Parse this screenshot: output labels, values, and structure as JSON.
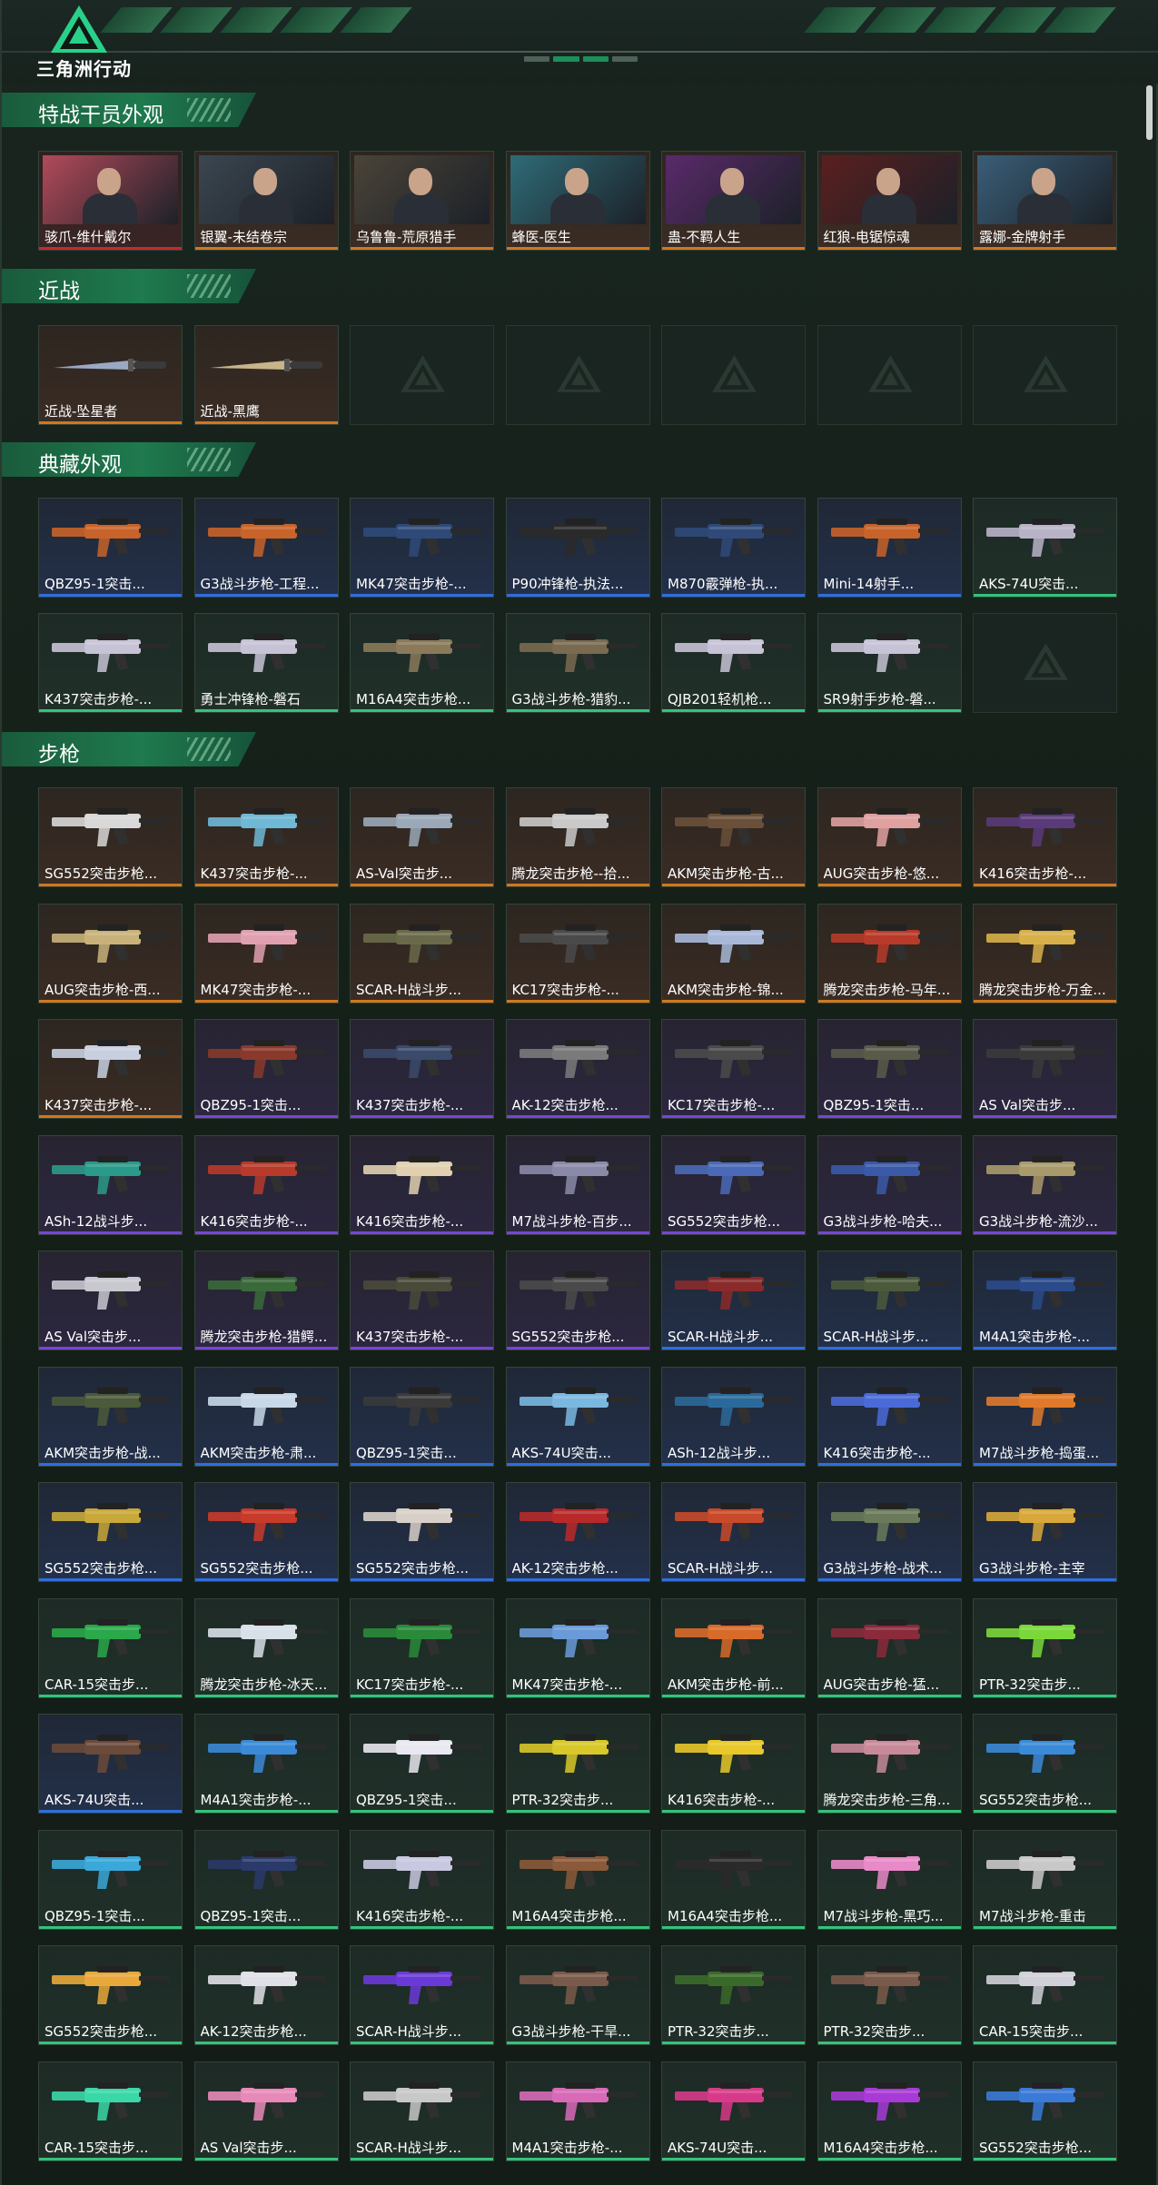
{
  "header": {
    "logo_text": "三角洲行动"
  },
  "sections": [
    {
      "key": "operators",
      "title": "特战干员外观",
      "rows": [
        [
          {
            "title": "骇爪-维什戴尔",
            "rarity": "red",
            "kind": "portrait",
            "tint": "#b24a5a"
          },
          {
            "title": "银翼-未结卷宗",
            "rarity": "orange",
            "kind": "portrait",
            "tint": "#3b4650"
          },
          {
            "title": "乌鲁鲁-荒原猎手",
            "rarity": "orange",
            "kind": "portrait",
            "tint": "#4a4338"
          },
          {
            "title": "蜂医-医生",
            "rarity": "orange",
            "kind": "portrait",
            "tint": "#2f6b77"
          },
          {
            "title": "蛊-不羁人生",
            "rarity": "orange",
            "kind": "portrait",
            "tint": "#5a2a6a"
          },
          {
            "title": "红狼-电锯惊魂",
            "rarity": "orange",
            "kind": "portrait",
            "tint": "#5a1f1f"
          },
          {
            "title": "露娜-金牌射手",
            "rarity": "orange",
            "kind": "portrait",
            "tint": "#3a5e78"
          }
        ]
      ]
    },
    {
      "key": "melee",
      "title": "近战",
      "rows": [
        [
          {
            "title": "近战-坠星者",
            "rarity": "orange",
            "kind": "knife",
            "tint": "#9aa8c4"
          },
          {
            "title": "近战-黑鹰",
            "rarity": "orange",
            "kind": "knife",
            "tint": "#c8b48a"
          },
          {
            "title": "",
            "rarity": "gray",
            "kind": "empty"
          },
          {
            "title": "",
            "rarity": "gray",
            "kind": "empty"
          },
          {
            "title": "",
            "rarity": "gray",
            "kind": "empty"
          },
          {
            "title": "",
            "rarity": "gray",
            "kind": "empty"
          },
          {
            "title": "",
            "rarity": "gray",
            "kind": "empty"
          }
        ]
      ]
    },
    {
      "key": "collection",
      "title": "典藏外观",
      "rows": [
        [
          {
            "title": "QBZ95-1突击...",
            "rarity": "blue",
            "kind": "gun",
            "tint": "#c8632a"
          },
          {
            "title": "G3战斗步枪-工程...",
            "rarity": "blue",
            "kind": "gun",
            "tint": "#c8632a"
          },
          {
            "title": "MK47突击步枪-...",
            "rarity": "blue",
            "kind": "gun",
            "tint": "#2f4a78"
          },
          {
            "title": "P90冲锋枪-执法...",
            "rarity": "blue",
            "kind": "gun",
            "tint": "#2a2a2a"
          },
          {
            "title": "M870霰弹枪-执...",
            "rarity": "blue",
            "kind": "gun",
            "tint": "#2f4a78"
          },
          {
            "title": "Mini-14射手...",
            "rarity": "blue",
            "kind": "gun",
            "tint": "#c8632a"
          },
          {
            "title": "AKS-74U突击...",
            "rarity": "green",
            "kind": "gun",
            "tint": "#b9b3c8"
          }
        ],
        [
          {
            "title": "K437突击步枪-...",
            "rarity": "green",
            "kind": "gun",
            "tint": "#c7c3d6"
          },
          {
            "title": "勇士冲锋枪-磐石",
            "rarity": "green",
            "kind": "gun",
            "tint": "#c7c3d6"
          },
          {
            "title": "M16A4突击步枪...",
            "rarity": "green",
            "kind": "gun",
            "tint": "#8a7a5a"
          },
          {
            "title": "G3战斗步枪-猎豹...",
            "rarity": "green",
            "kind": "gun",
            "tint": "#7a6a50"
          },
          {
            "title": "QJB201轻机枪...",
            "rarity": "green",
            "kind": "gun",
            "tint": "#c7c3d6"
          },
          {
            "title": "SR9射手步枪-磐...",
            "rarity": "green",
            "kind": "gun",
            "tint": "#c7c3d6"
          },
          {
            "title": "",
            "rarity": "gray",
            "kind": "empty"
          }
        ]
      ]
    },
    {
      "key": "rifles",
      "title": "步枪",
      "rows": [
        [
          {
            "title": "SG552突击步枪...",
            "rarity": "orange",
            "kind": "gun",
            "tint": "#d8d8d8"
          },
          {
            "title": "K437突击步枪-...",
            "rarity": "orange",
            "kind": "gun",
            "tint": "#6fb8d6"
          },
          {
            "title": "AS-Val突击步...",
            "rarity": "orange",
            "kind": "gun",
            "tint": "#9aa8b8"
          },
          {
            "title": "腾龙突击步枪--拾...",
            "rarity": "orange",
            "kind": "gun",
            "tint": "#c9c9c9"
          },
          {
            "title": "AKM突击步枪-古...",
            "rarity": "orange",
            "kind": "gun",
            "tint": "#6a5038"
          },
          {
            "title": "AUG突击步枪-悠...",
            "rarity": "orange",
            "kind": "gun",
            "tint": "#e0a0a0"
          },
          {
            "title": "K416突击步枪-...",
            "rarity": "orange",
            "kind": "gun",
            "tint": "#5a3a7a"
          }
        ],
        [
          {
            "title": "AUG突击步枪-西...",
            "rarity": "orange",
            "kind": "gun",
            "tint": "#c8b27a"
          },
          {
            "title": "MK47突击步枪-...",
            "rarity": "orange",
            "kind": "gun",
            "tint": "#e0a0b0"
          },
          {
            "title": "SCAR-H战斗步...",
            "rarity": "orange",
            "kind": "gun",
            "tint": "#6a6a4a"
          },
          {
            "title": "KC17突击步枪-...",
            "rarity": "orange",
            "kind": "gun",
            "tint": "#4a4a4a"
          },
          {
            "title": "AKM突击步枪-锦...",
            "rarity": "orange",
            "kind": "gun",
            "tint": "#a8b8d8"
          },
          {
            "title": "腾龙突击步枪-马年...",
            "rarity": "orange",
            "kind": "gun",
            "tint": "#b83a2a"
          },
          {
            "title": "腾龙突击步枪-万金...",
            "rarity": "orange",
            "kind": "gun",
            "tint": "#d8b04a"
          }
        ],
        [
          {
            "title": "K437突击步枪-...",
            "rarity": "orange",
            "kind": "gun",
            "tint": "#c8d0e0"
          },
          {
            "title": "QBZ95-1突击...",
            "rarity": "purple",
            "kind": "gun",
            "tint": "#8a3a2a"
          },
          {
            "title": "K437突击步枪-...",
            "rarity": "purple",
            "kind": "gun",
            "tint": "#3a4a6a"
          },
          {
            "title": "AK-12突击步枪...",
            "rarity": "purple",
            "kind": "gun",
            "tint": "#7a7a7a"
          },
          {
            "title": "KC17突击步枪-...",
            "rarity": "purple",
            "kind": "gun",
            "tint": "#4a4a4a"
          },
          {
            "title": "QBZ95-1突击...",
            "rarity": "purple",
            "kind": "gun",
            "tint": "#5a5a4a"
          },
          {
            "title": "AS Val突击步...",
            "rarity": "purple",
            "kind": "gun",
            "tint": "#3a3a3a"
          }
        ],
        [
          {
            "title": "ASh-12战斗步...",
            "rarity": "purple",
            "kind": "gun",
            "tint": "#2a9a8a"
          },
          {
            "title": "K416突击步枪-...",
            "rarity": "purple",
            "kind": "gun",
            "tint": "#b83a2a"
          },
          {
            "title": "K416突击步枪-...",
            "rarity": "purple",
            "kind": "gun",
            "tint": "#e0d0b0"
          },
          {
            "title": "M7战斗步枪-百步...",
            "rarity": "purple",
            "kind": "gun",
            "tint": "#8a8aa8"
          },
          {
            "title": "SG552突击步枪...",
            "rarity": "purple",
            "kind": "gun",
            "tint": "#4a6ab8"
          },
          {
            "title": "G3战斗步枪-哈夫...",
            "rarity": "purple",
            "kind": "gun",
            "tint": "#3a5aa8"
          },
          {
            "title": "G3战斗步枪-流沙...",
            "rarity": "purple",
            "kind": "gun",
            "tint": "#a89a6a"
          }
        ],
        [
          {
            "title": "AS Val突击步...",
            "rarity": "purple",
            "kind": "gun",
            "tint": "#c8c8d0"
          },
          {
            "title": "腾龙突击步枪-猎鳄...",
            "rarity": "purple",
            "kind": "gun",
            "tint": "#3a6a3a"
          },
          {
            "title": "K437突击步枪-...",
            "rarity": "purple",
            "kind": "gun",
            "tint": "#4a4a3a"
          },
          {
            "title": "SG552突击步枪...",
            "rarity": "purple",
            "kind": "gun",
            "tint": "#4a4a4a"
          },
          {
            "title": "SCAR-H战斗步...",
            "rarity": "blue",
            "kind": "gun",
            "tint": "#8a2a2a"
          },
          {
            "title": "SCAR-H战斗步...",
            "rarity": "blue",
            "kind": "gun",
            "tint": "#4a5a3a"
          },
          {
            "title": "M4A1突击步枪-...",
            "rarity": "blue",
            "kind": "gun",
            "tint": "#2a4a8a"
          }
        ],
        [
          {
            "title": "AKM突击步枪-战...",
            "rarity": "blue",
            "kind": "gun",
            "tint": "#4a5a3a"
          },
          {
            "title": "AKM突击步枪-肃...",
            "rarity": "blue",
            "kind": "gun",
            "tint": "#c8d8e8"
          },
          {
            "title": "QBZ95-1突击...",
            "rarity": "blue",
            "kind": "gun",
            "tint": "#3a3a3a"
          },
          {
            "title": "AKS-74U突击...",
            "rarity": "blue",
            "kind": "gun",
            "tint": "#7ab8e0"
          },
          {
            "title": "ASh-12战斗步...",
            "rarity": "blue",
            "kind": "gun",
            "tint": "#2a6a9a"
          },
          {
            "title": "K416突击步枪-...",
            "rarity": "blue",
            "kind": "gun",
            "tint": "#4a6ad8"
          },
          {
            "title": "M7战斗步枪-捣蛋...",
            "rarity": "blue",
            "kind": "gun",
            "tint": "#e07a2a"
          }
        ],
        [
          {
            "title": "SG552突击步枪...",
            "rarity": "blue",
            "kind": "gun",
            "tint": "#c8a83a"
          },
          {
            "title": "SG552突击步枪...",
            "rarity": "blue",
            "kind": "gun",
            "tint": "#c83a2a"
          },
          {
            "title": "SG552突击步枪...",
            "rarity": "blue",
            "kind": "gun",
            "tint": "#d8d0c8"
          },
          {
            "title": "AK-12突击步枪...",
            "rarity": "blue",
            "kind": "gun",
            "tint": "#b82a2a"
          },
          {
            "title": "SCAR-H战斗步...",
            "rarity": "blue",
            "kind": "gun",
            "tint": "#c84a2a"
          },
          {
            "title": "G3战斗步枪-战术...",
            "rarity": "blue",
            "kind": "gun",
            "tint": "#6a7a5a"
          },
          {
            "title": "G3战斗步枪-主宰",
            "rarity": "blue",
            "kind": "gun",
            "tint": "#d8a83a"
          }
        ],
        [
          {
            "title": "CAR-15突击步...",
            "rarity": "green",
            "kind": "gun",
            "tint": "#2aa84a"
          },
          {
            "title": "腾龙突击步枪-冰天...",
            "rarity": "green",
            "kind": "gun",
            "tint": "#d8e0e8"
          },
          {
            "title": "KC17突击步枪-...",
            "rarity": "green",
            "kind": "gun",
            "tint": "#2a8a3a"
          },
          {
            "title": "MK47突击步枪-...",
            "rarity": "green",
            "kind": "gun",
            "tint": "#6a9ad8"
          },
          {
            "title": "AKM突击步枪-前...",
            "rarity": "green",
            "kind": "gun",
            "tint": "#d86a2a"
          },
          {
            "title": "AUG突击步枪-猛...",
            "rarity": "green",
            "kind": "gun",
            "tint": "#8a2a3a"
          },
          {
            "title": "PTR-32突击步...",
            "rarity": "green",
            "kind": "gun",
            "tint": "#7ad83a"
          }
        ],
        [
          {
            "title": "AKS-74U突击...",
            "rarity": "blue",
            "kind": "gun",
            "tint": "#6a4a3a"
          },
          {
            "title": "M4A1突击步枪-...",
            "rarity": "green",
            "kind": "gun",
            "tint": "#3a8ad8"
          },
          {
            "title": "QBZ95-1突击...",
            "rarity": "green",
            "kind": "gun",
            "tint": "#e8e8f0"
          },
          {
            "title": "PTR-32突击步...",
            "rarity": "green",
            "kind": "gun",
            "tint": "#d8c82a"
          },
          {
            "title": "K416突击步枪-...",
            "rarity": "green",
            "kind": "gun",
            "tint": "#e8c82a"
          },
          {
            "title": "腾龙突击步枪-三角...",
            "rarity": "green",
            "kind": "gun",
            "tint": "#c88a9a"
          },
          {
            "title": "SG552突击步枪...",
            "rarity": "green",
            "kind": "gun",
            "tint": "#3a8ad8"
          }
        ],
        [
          {
            "title": "QBZ95-1突击...",
            "rarity": "green",
            "kind": "gun",
            "tint": "#3aa8d8"
          },
          {
            "title": "QBZ95-1突击...",
            "rarity": "green",
            "kind": "gun",
            "tint": "#2a3a6a"
          },
          {
            "title": "K416突击步枪-...",
            "rarity": "green",
            "kind": "gun",
            "tint": "#c8c8e0"
          },
          {
            "title": "M16A4突击步枪...",
            "rarity": "green",
            "kind": "gun",
            "tint": "#8a5a3a"
          },
          {
            "title": "M16A4突击步枪...",
            "rarity": "green",
            "kind": "gun",
            "tint": "#2a2a2a"
          },
          {
            "title": "M7战斗步枪-黑巧...",
            "rarity": "green",
            "kind": "gun",
            "tint": "#e88ac8"
          },
          {
            "title": "M7战斗步枪-重击",
            "rarity": "green",
            "kind": "gun",
            "tint": "#c8c8c8"
          }
        ],
        [
          {
            "title": "SG552突击步枪...",
            "rarity": "green",
            "kind": "gun",
            "tint": "#e8a83a"
          },
          {
            "title": "AK-12突击步枪...",
            "rarity": "green",
            "kind": "gun",
            "tint": "#e0e0e8"
          },
          {
            "title": "SCAR-H战斗步...",
            "rarity": "green",
            "kind": "gun",
            "tint": "#6a3ad8"
          },
          {
            "title": "G3战斗步枪-干旱...",
            "rarity": "green",
            "kind": "gun",
            "tint": "#7a5a4a"
          },
          {
            "title": "PTR-32突击步...",
            "rarity": "green",
            "kind": "gun",
            "tint": "#3a6a2a"
          },
          {
            "title": "PTR-32突击步...",
            "rarity": "green",
            "kind": "gun",
            "tint": "#7a5a4a"
          },
          {
            "title": "CAR-15突击步...",
            "rarity": "green",
            "kind": "gun",
            "tint": "#d0d0d8"
          }
        ],
        [
          {
            "title": "CAR-15突击步...",
            "rarity": "green",
            "kind": "gun",
            "tint": "#3ad8a8"
          },
          {
            "title": "AS Val突击步...",
            "rarity": "green",
            "kind": "gun",
            "tint": "#e88ab8"
          },
          {
            "title": "SCAR-H战斗步...",
            "rarity": "green",
            "kind": "gun",
            "tint": "#c8c8c8"
          },
          {
            "title": "M4A1突击步枪-...",
            "rarity": "green",
            "kind": "gun",
            "tint": "#d86ab8"
          },
          {
            "title": "AKS-74U突击...",
            "rarity": "green",
            "kind": "gun",
            "tint": "#d83a8a"
          },
          {
            "title": "M16A4突击步枪...",
            "rarity": "green",
            "kind": "gun",
            "tint": "#a83ad8"
          },
          {
            "title": "SG552突击步枪...",
            "rarity": "green",
            "kind": "gun",
            "tint": "#3a7ad8"
          }
        ]
      ]
    }
  ]
}
